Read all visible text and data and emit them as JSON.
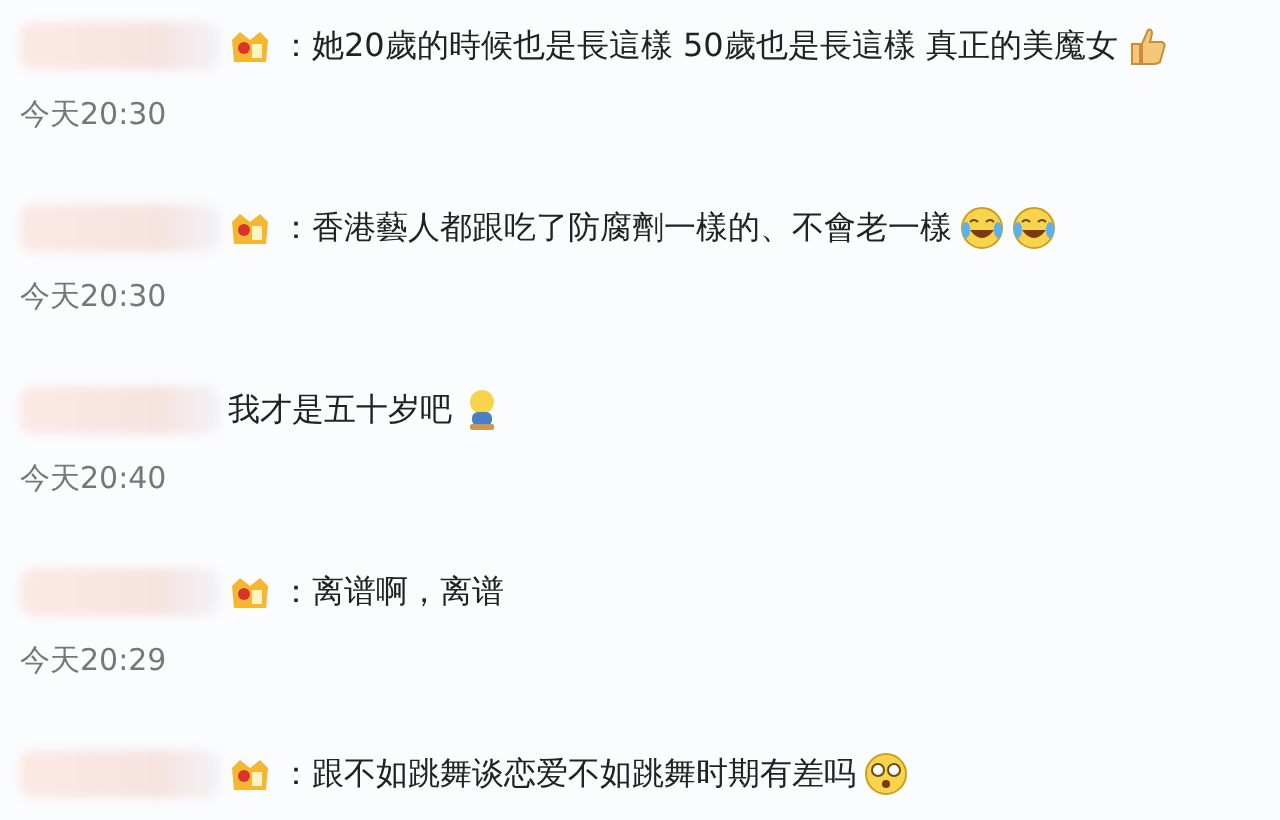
{
  "comments": [
    {
      "badge": true,
      "text": "：她20歲的時候也是長這樣 50歲也是長這樣 真正的美魔女",
      "emoji": [
        {
          "kind": "thumbs-up"
        }
      ],
      "time": "今天20:30"
    },
    {
      "badge": true,
      "text": "：香港藝人都跟吃了防腐劑一樣的、不會老一樣",
      "emoji": [
        {
          "kind": "laughing"
        },
        {
          "kind": "laughing"
        }
      ],
      "time": "今天20:30"
    },
    {
      "badge": false,
      "text": "我才是五十岁吧",
      "emoji": [
        {
          "kind": "sitting"
        }
      ],
      "time": "今天20:40"
    },
    {
      "badge": true,
      "text": "：离谱啊，离谱",
      "time": "今天20:29"
    },
    {
      "badge": true,
      "text": "：跟不如跳舞谈恋爱不如跳舞时期有差吗",
      "emoji": [
        {
          "kind": "dizzy"
        }
      ]
    }
  ]
}
